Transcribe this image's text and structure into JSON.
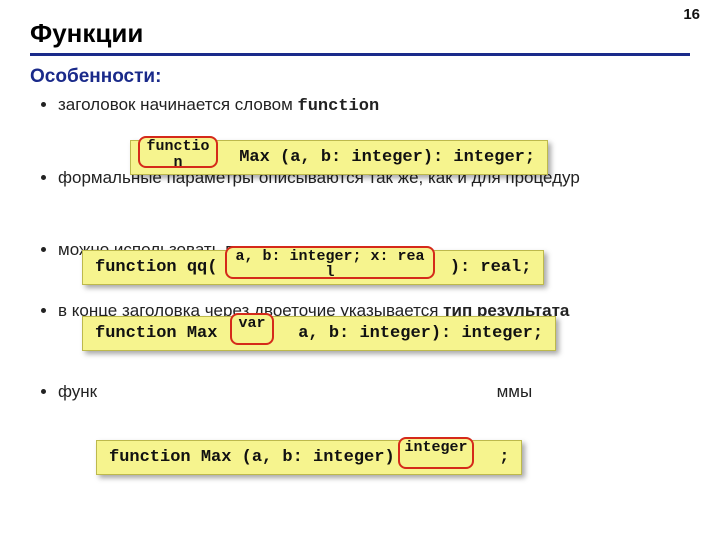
{
  "page_number": "16",
  "title": "Функции",
  "subhead": "Особенности:",
  "bullets": {
    "b1_pre": "заголовок начинается словом ",
    "b1_kw": "function",
    "b2": "формальные параметры описываются так же, как и для процедур",
    "b3": "можно использовать параметры-переменные",
    "b4_pre": "в конце заголовка через двоеточие указывается ",
    "b4_bold": "тип результата",
    "b5_pre": "функ",
    "b5_post": "ммы"
  },
  "code": {
    "box1": {
      "after": " Max (a, b: integer): integer;"
    },
    "box2": {
      "before": "function qq( ",
      "after": " ): real;"
    },
    "box3": {
      "before": "function Max ( ",
      "after": " a, b: integer): integer;"
    },
    "box4": {
      "before": "function Max (a, b: integer): ",
      "after": " ;"
    }
  },
  "labels": {
    "l1": "function",
    "l2": "a, b: integer; x: real",
    "l3": "var",
    "l4": "integer"
  }
}
